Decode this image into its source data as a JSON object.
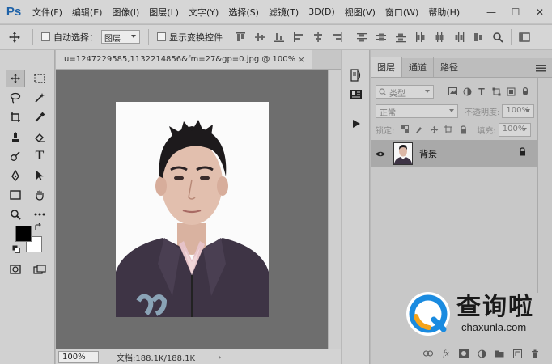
{
  "app": {
    "logo": "Ps"
  },
  "menu": [
    "文件(F)",
    "编辑(E)",
    "图像(I)",
    "图层(L)",
    "文字(Y)",
    "选择(S)",
    "滤镜(T)",
    "3D(D)",
    "视图(V)",
    "窗口(W)",
    "帮助(H)"
  ],
  "window_controls": {
    "minimize": "—",
    "restore": "☐",
    "close": "✕"
  },
  "options": {
    "auto_select_label": "自动选择：",
    "auto_select_value": "图层",
    "show_transform_label": "显示变换控件"
  },
  "document": {
    "title": "u=1247229585,1132214856&fm=27&gp=0.jpg @ 100%...",
    "close": "×",
    "zoom": "100%",
    "info": "文档:188.1K/188.1K",
    "status_arrow": "›"
  },
  "layers_panel": {
    "tabs": [
      "图层",
      "通道",
      "路径"
    ],
    "filter_placeholder": "类型",
    "blend_mode": "正常",
    "opacity_label": "不透明度:",
    "opacity_value": "100%",
    "lock_label": "锁定:",
    "fill_label": "填充:",
    "fill_value": "100%",
    "layer_name": "背景"
  },
  "watermark": {
    "cn": "查询啦",
    "en": "chaxunla.com"
  },
  "colors": {
    "foreground": "#000000",
    "background": "#ffffff",
    "logo_blue": "#1e62a8",
    "watermark_blue": "#1a8be0",
    "watermark_orange": "#f5a31a"
  }
}
